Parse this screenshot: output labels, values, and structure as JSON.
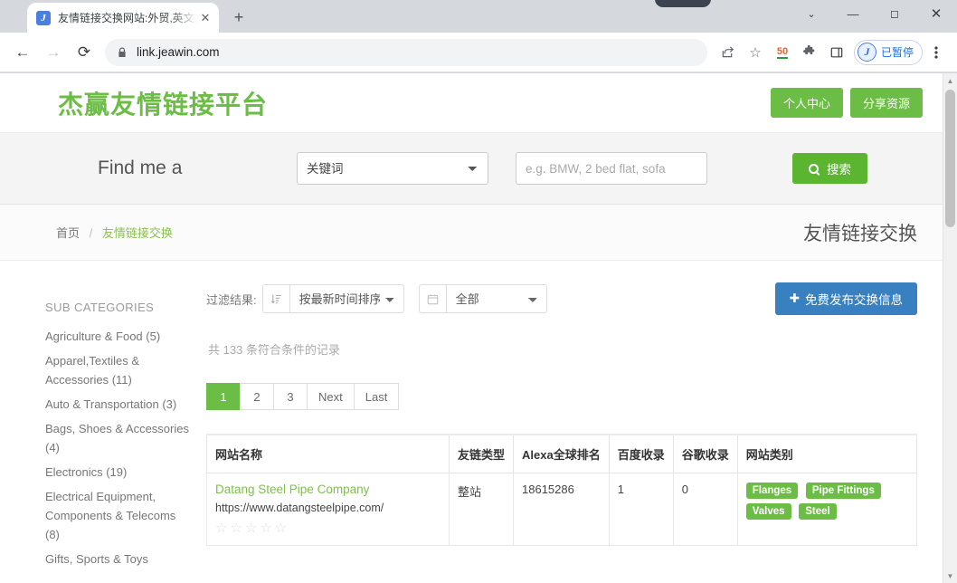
{
  "browser": {
    "tab": {
      "title": "友情链接交换网站:外贸,英文,谷歌",
      "favicon": "J",
      "close_label": "✕"
    },
    "newtab_label": "+",
    "window_controls": {
      "chevron": "⌄",
      "minimize": "—",
      "maximize": "◻",
      "close": "✕"
    },
    "nav": {
      "back": "←",
      "forward": "→",
      "reload": "⟳"
    },
    "omnibox": {
      "lock": "🔒",
      "url": "link.jeawin.com"
    },
    "actions": {
      "share": "↱",
      "bookmark": "☆",
      "extension_badge": "50",
      "puzzle": "🧩",
      "sidepanel": "▯",
      "menu": "⋮"
    },
    "ext_pill": {
      "icon": "J",
      "label": "已暂停"
    }
  },
  "site": {
    "logo": "杰赢友情链接平台",
    "header_buttons": [
      {
        "label": "个人中心"
      },
      {
        "label": "分享资源"
      }
    ]
  },
  "search": {
    "find_label": "Find me a",
    "category_selected": "关键词",
    "keyword_placeholder": "e.g. BMW, 2 bed flat, sofa",
    "keyword_value": "",
    "button_label": "搜索"
  },
  "breadcrumb": {
    "home": "首页",
    "separator": "/",
    "current": "友情链接交换",
    "page_title": "友情链接交换"
  },
  "sidebar": {
    "heading": "SUB CATEGORIES",
    "items": [
      {
        "label": "Agriculture & Food (5)"
      },
      {
        "label": "Apparel,Textiles & Accessories (11)"
      },
      {
        "label": "Auto & Transportation (3)"
      },
      {
        "label": "Bags, Shoes & Accessories (4)"
      },
      {
        "label": "Electronics (19)"
      },
      {
        "label": "Electrical Equipment, Components & Telecoms (8)"
      },
      {
        "label": "Gifts, Sports & Toys"
      }
    ]
  },
  "filters": {
    "label": "过滤结果:",
    "sort_selected": "按最新时间排序",
    "date_selected": "全部",
    "publish_button": "免费发布交换信息",
    "publish_icon": "✚",
    "sort_icon": "sort-desc-icon",
    "calendar_icon": "calendar-icon"
  },
  "results": {
    "count_text": "共 133 条符合条件的记录",
    "pagination": [
      {
        "label": "1",
        "active": true
      },
      {
        "label": "2",
        "active": false
      },
      {
        "label": "3",
        "active": false
      },
      {
        "label": "Next",
        "active": false
      },
      {
        "label": "Last",
        "active": false
      }
    ],
    "columns": [
      "网站名称",
      "友链类型",
      "Alexa全球排名",
      "百度收录",
      "谷歌收录",
      "网站类别"
    ],
    "rows": [
      {
        "name": "Datang Steel Pipe Company",
        "url": "https://www.datangsteelpipe.com/",
        "stars": "☆☆☆☆☆",
        "type": "整站",
        "alexa": "18615286",
        "baidu": "1",
        "google": "0",
        "tags": [
          "Flanges",
          "Pipe Fittings",
          "Valves",
          "Steel"
        ]
      }
    ]
  },
  "colors": {
    "brand_green": "#6cbd45",
    "search_green": "#5cb531",
    "publish_blue": "#3880c0",
    "link_green": "#8cc152"
  }
}
